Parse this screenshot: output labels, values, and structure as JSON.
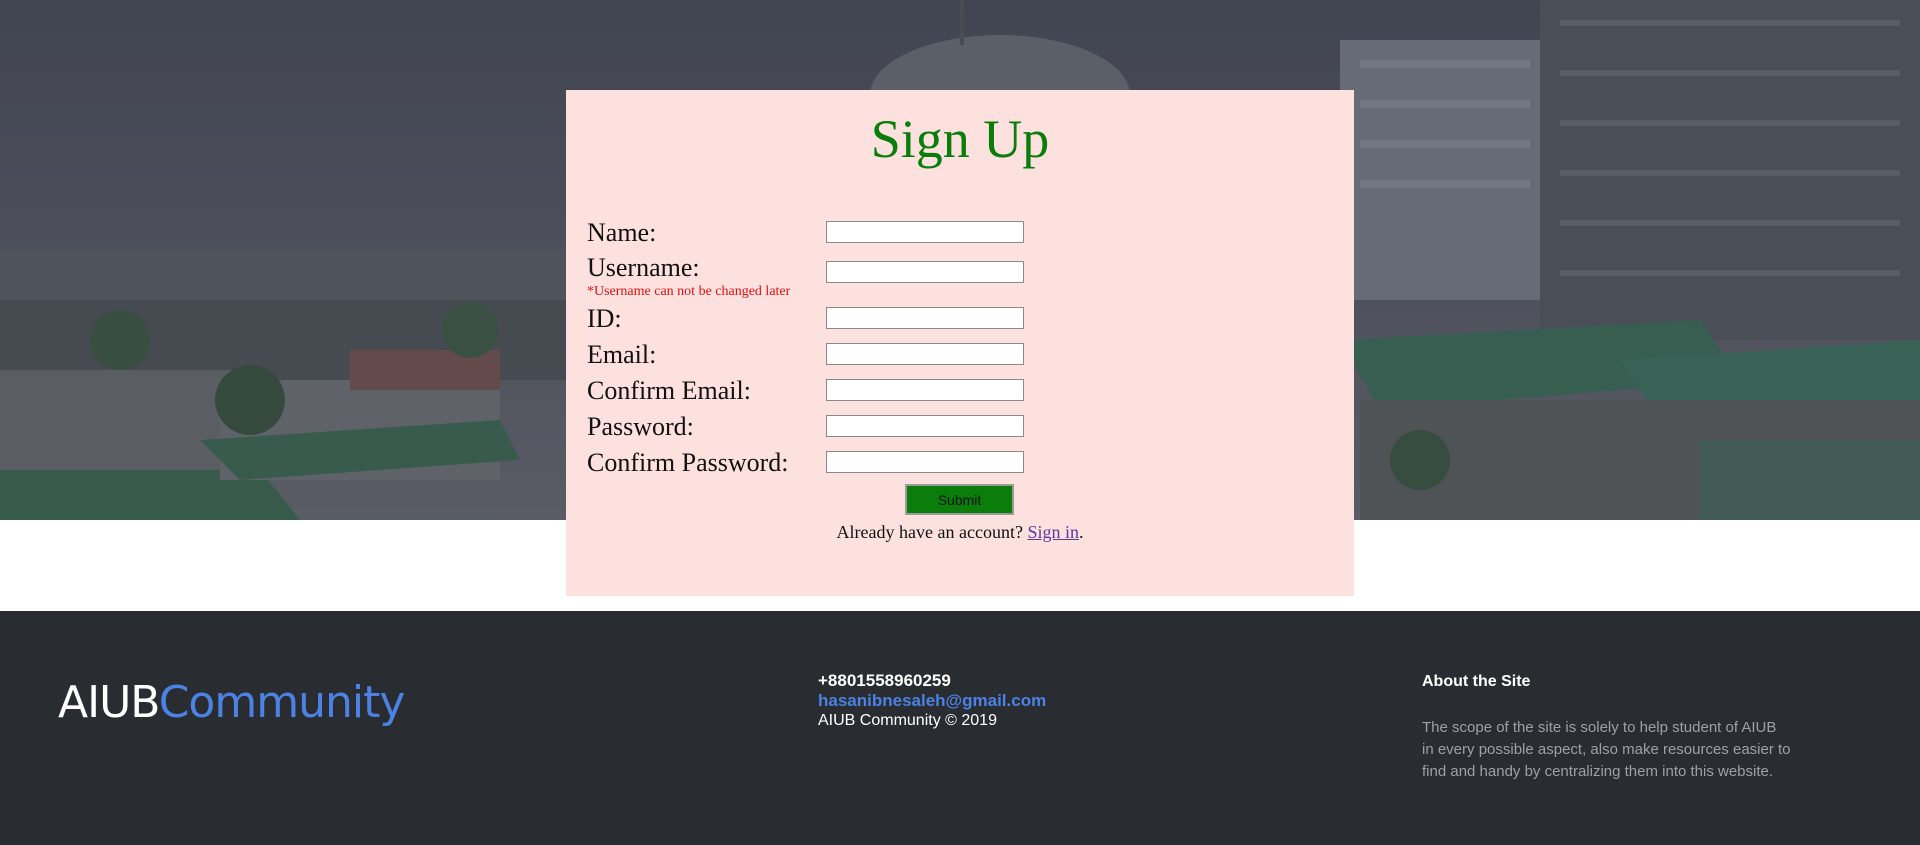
{
  "form": {
    "title": "Sign Up",
    "fields": [
      {
        "label": "Name:",
        "value": ""
      },
      {
        "label": "Username:",
        "value": ""
      },
      {
        "label": "ID:",
        "value": ""
      },
      {
        "label": "Email:",
        "value": ""
      },
      {
        "label": "Confirm Email:",
        "value": ""
      },
      {
        "label": "Password:",
        "value": ""
      },
      {
        "label": "Confirm Password:",
        "value": ""
      }
    ],
    "username_hint": "*Username can not be changed later",
    "submit_label": "Submit",
    "signin_prefix": "Already have an account? ",
    "signin_link": "Sign in",
    "signin_suffix": "."
  },
  "footer": {
    "logo_part1": "AIUB",
    "logo_part2": "Community",
    "phone": "+8801558960259",
    "email": "hasanibnesaleh@gmail.com",
    "copyright": "AIUB Community © 2019",
    "about_title": "About the Site",
    "about_text": "The scope of the site is solely to help student of AIUB in every possible aspect, also make resources easier to find and handy by centralizing them into this website."
  },
  "colors": {
    "card_bg": "#fde1df",
    "title": "#0a7d0a",
    "submit_bg": "#0a7d0a",
    "hint": "#e01010",
    "footer_bg": "#292c31",
    "accent_blue": "#4b82e3"
  }
}
